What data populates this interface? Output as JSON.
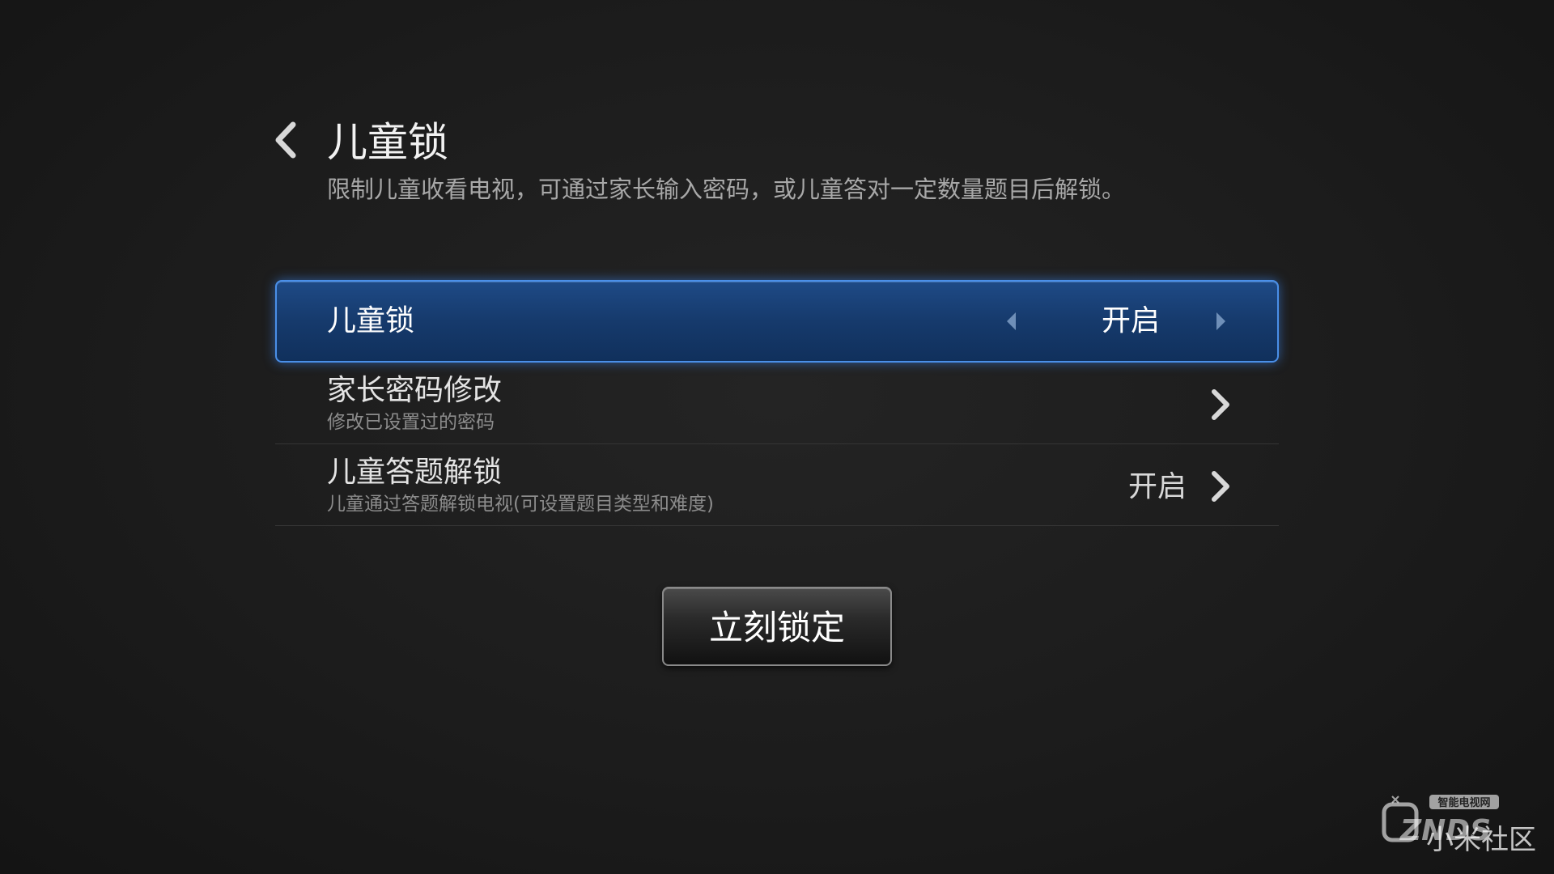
{
  "header": {
    "title": "儿童锁",
    "subtitle": "限制儿童收看电视，可通过家长输入密码，或儿童答对一定数量题目后解锁。"
  },
  "settings": {
    "child_lock": {
      "label": "儿童锁",
      "value": "开启"
    },
    "parent_password": {
      "label": "家长密码修改",
      "description": "修改已设置过的密码"
    },
    "quiz_unlock": {
      "label": "儿童答题解锁",
      "description": "儿童通过答题解锁电视(可设置题目类型和难度)",
      "value": "开启"
    }
  },
  "actions": {
    "lock_now_label": "立刻锁定"
  },
  "watermark": {
    "brand_top": "智能电视网",
    "brand_logo": "ZNDS",
    "community": "小米社区"
  },
  "colors": {
    "background": "#1d1d1d",
    "selected_row": "#1a4176",
    "selected_border": "#4a8fe8"
  }
}
